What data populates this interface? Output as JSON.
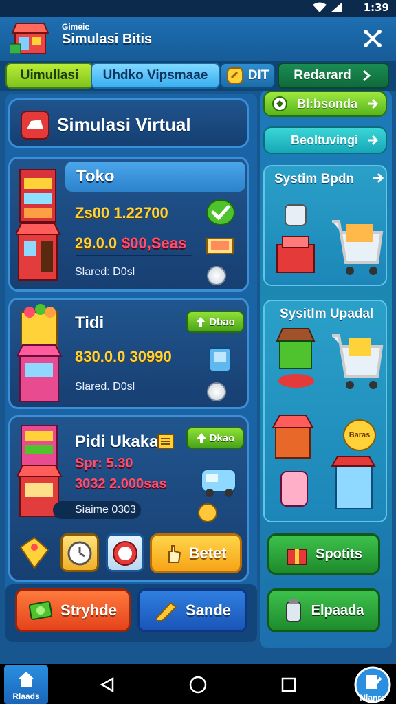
{
  "status_bar": {
    "time": "1:39"
  },
  "header": {
    "subtitle": "Gimeic",
    "title": "Simulasi Bitis"
  },
  "tabs": [
    {
      "label": "Uimullasi"
    },
    {
      "label": "Uhdko Vipsmaae"
    },
    {
      "label": "DIT"
    },
    {
      "label": "Redarard"
    }
  ],
  "virtual_panel": {
    "title": "Simulasi Virtual"
  },
  "stores": [
    {
      "name": "Toko",
      "value_1": "Zs00 1.22700",
      "value_2a": "29.0.0",
      "value_2b": "$00,Seas",
      "status": "Slared: D0sl"
    },
    {
      "name": "Tidi",
      "badge": "Dbao",
      "value_1": "830.0.0 30990",
      "status": "Slared. D0sl"
    },
    {
      "name": "Pidi Ukaka",
      "badge": "Dkao",
      "value_1": "Spr: 5.30",
      "value_2": "3032 2.000sas",
      "status": "Siaime 0303"
    }
  ],
  "actions": {
    "bet_label": "Betet"
  },
  "bottom_buttons": {
    "left": "Stryhde",
    "right": "Sande"
  },
  "sidebar": {
    "btn1": "Bl:bsonda",
    "btn2": "Beoltuvingi",
    "panel1_title": "Systim Bpdn",
    "panel2_title": "Sysitlm Upadal",
    "badge": "Baras",
    "spotits": "Spotits",
    "elpada": "Elpaada"
  },
  "nav": {
    "home_label": "Rlaads",
    "map_label": "Nlanre"
  },
  "colors": {
    "primary_blue": "#1a64a6",
    "lime": "#8fe036",
    "yellow": "#ffd23a",
    "orange": "#e4431b",
    "green": "#1e8a2d"
  }
}
